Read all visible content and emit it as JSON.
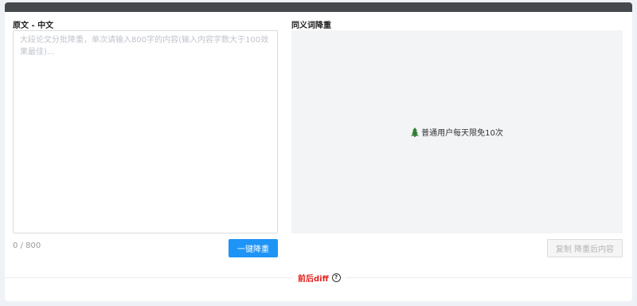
{
  "source": {
    "label": "原文 - 中文",
    "placeholder": "大段论文分批降重，单次请输入800字的内容(输入内容字数大于100效果最佳)...",
    "value": "",
    "counter": "0 / 800",
    "submit_label": "一键降重"
  },
  "output": {
    "label": "同义词降重",
    "notice": "普通用户每天限免10次",
    "notice_icon": "tree-icon",
    "copy_label": "复制 降重后内容"
  },
  "footer": {
    "diff_label": "前后diff",
    "help_icon": "question-circle-icon"
  },
  "colors": {
    "accent": "#1e94f6",
    "diff": "#e02020",
    "topbar": "#45484d"
  }
}
